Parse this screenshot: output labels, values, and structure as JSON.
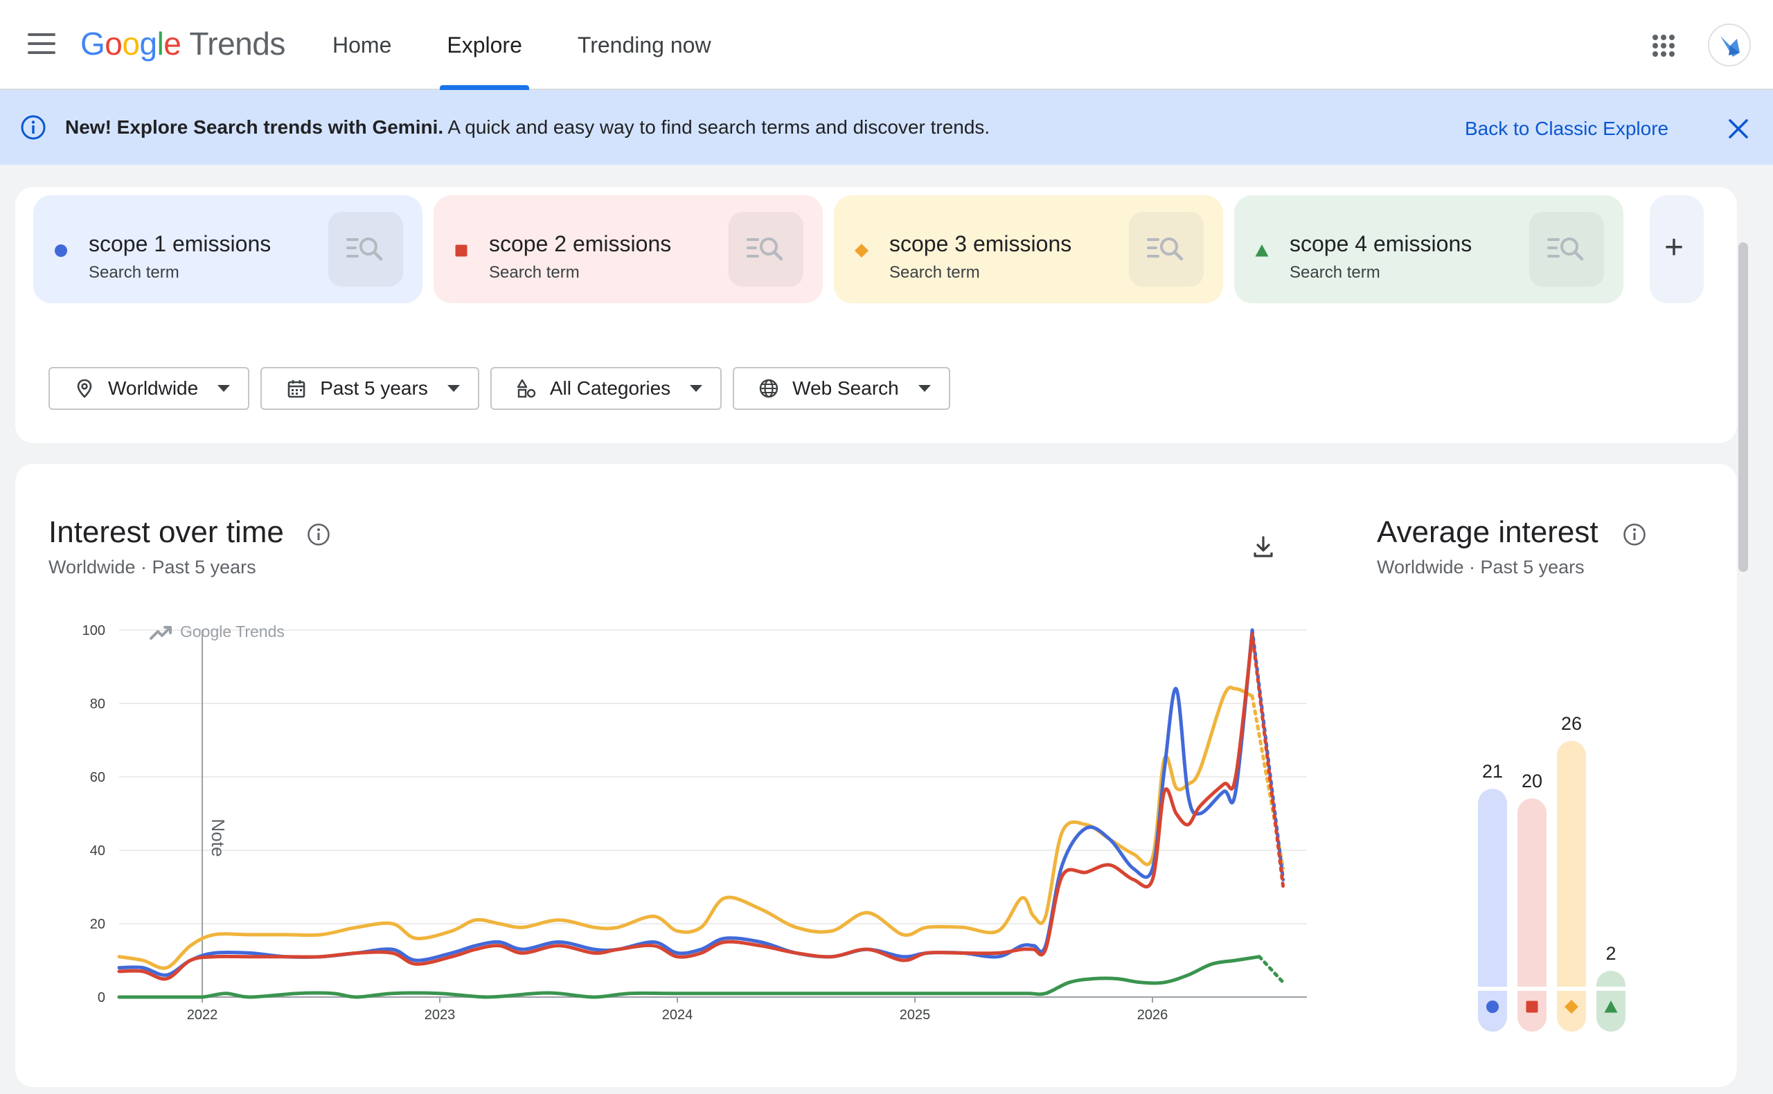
{
  "header": {
    "logo_google": "Google",
    "logo_trends": "Trends",
    "nav": [
      {
        "label": "Home",
        "active": false
      },
      {
        "label": "Explore",
        "active": true
      },
      {
        "label": "Trending now",
        "active": false
      }
    ]
  },
  "banner": {
    "bold": "New! Explore Search trends with Gemini.",
    "text": " A quick and easy way to find search terms and discover trends.",
    "link": "Back to Classic Explore"
  },
  "terms": [
    {
      "name": "scope 1 emissions",
      "sub": "Search term",
      "color": "#4169d9",
      "bg": "#e8efff",
      "btn": "#dde3f0",
      "marker": "circle"
    },
    {
      "name": "scope 2 emissions",
      "sub": "Search term",
      "color": "#d64532",
      "bg": "#fdeceb",
      "btn": "#f0e0df",
      "marker": "square"
    },
    {
      "name": "scope 3 emissions",
      "sub": "Search term",
      "color": "#f0a229",
      "bg": "#fef4d6",
      "btn": "#f3ead2",
      "marker": "diamond"
    },
    {
      "name": "scope 4 emissions",
      "sub": "Search term",
      "color": "#3a944f",
      "bg": "#e7f3ea",
      "btn": "#dde9e0",
      "marker": "triangle"
    }
  ],
  "filters": {
    "location": "Worldwide",
    "time": "Past 5 years",
    "category": "All Categories",
    "property": "Web Search"
  },
  "interest_over_time": {
    "title": "Interest over time",
    "subtitle": "Worldwide  ·  Past 5 years",
    "watermark": "Google Trends",
    "note_label": "Note"
  },
  "average_interest": {
    "title": "Average interest",
    "subtitle": "Worldwide  ·  Past 5 years"
  },
  "chart_data": [
    {
      "type": "line",
      "ylim": [
        0,
        100
      ],
      "yticks": [
        0,
        20,
        40,
        60,
        80,
        100
      ],
      "xlim": [
        2021.65,
        2026.65
      ],
      "xticks": [
        {
          "label": "2022",
          "x": 2022.0
        },
        {
          "label": "2023",
          "x": 2023.0
        },
        {
          "label": "2024",
          "x": 2024.0
        },
        {
          "label": "2025",
          "x": 2025.0
        },
        {
          "label": "2026",
          "x": 2026.0
        }
      ],
      "note_x": 2022.0,
      "series": [
        {
          "name": "scope 1 emissions",
          "color": "#4169d9",
          "x": [
            2021.65,
            2021.75,
            2021.85,
            2021.95,
            2022.05,
            2022.2,
            2022.35,
            2022.5,
            2022.65,
            2022.8,
            2022.9,
            2023.05,
            2023.15,
            2023.25,
            2023.35,
            2023.5,
            2023.65,
            2023.75,
            2023.9,
            2024.0,
            2024.1,
            2024.2,
            2024.35,
            2024.5,
            2024.65,
            2024.8,
            2024.95,
            2025.05,
            2025.2,
            2025.35,
            2025.45,
            2025.5,
            2025.55,
            2025.62,
            2025.72,
            2025.82,
            2025.92,
            2026.0,
            2026.05,
            2026.1,
            2026.15,
            2026.2,
            2026.3,
            2026.35,
            2026.42,
            2026.55
          ],
          "values": [
            8,
            8,
            6,
            10,
            12,
            12,
            11,
            11,
            12,
            13,
            10,
            12,
            14,
            15,
            13,
            15,
            13,
            13,
            15,
            12,
            13,
            16,
            15,
            12,
            11,
            13,
            11,
            12,
            12,
            11,
            14,
            14,
            14,
            36,
            46,
            43,
            35,
            35,
            62,
            84,
            55,
            50,
            56,
            56,
            100,
            32
          ]
        },
        {
          "name": "scope 2 emissions",
          "color": "#d64532",
          "x": [
            2021.65,
            2021.75,
            2021.85,
            2021.95,
            2022.05,
            2022.2,
            2022.35,
            2022.5,
            2022.65,
            2022.8,
            2022.9,
            2023.05,
            2023.15,
            2023.25,
            2023.35,
            2023.5,
            2023.65,
            2023.75,
            2023.9,
            2024.0,
            2024.1,
            2024.2,
            2024.35,
            2024.5,
            2024.65,
            2024.8,
            2024.95,
            2025.05,
            2025.2,
            2025.35,
            2025.45,
            2025.5,
            2025.55,
            2025.62,
            2025.72,
            2025.82,
            2025.92,
            2026.0,
            2026.05,
            2026.1,
            2026.15,
            2026.2,
            2026.3,
            2026.35,
            2026.42,
            2026.55
          ],
          "values": [
            7,
            7,
            5,
            10,
            11,
            11,
            11,
            11,
            12,
            12,
            9,
            11,
            13,
            14,
            12,
            14,
            12,
            13,
            14,
            11,
            12,
            15,
            14,
            12,
            11,
            13,
            10,
            12,
            12,
            12,
            13,
            13,
            13,
            33,
            34,
            36,
            32,
            32,
            56,
            50,
            47,
            52,
            58,
            60,
            99,
            30
          ]
        },
        {
          "name": "scope 3 emissions",
          "color": "#f0b43c",
          "x": [
            2021.65,
            2021.75,
            2021.85,
            2021.95,
            2022.05,
            2022.2,
            2022.35,
            2022.5,
            2022.65,
            2022.8,
            2022.9,
            2023.05,
            2023.15,
            2023.25,
            2023.35,
            2023.5,
            2023.65,
            2023.75,
            2023.9,
            2024.0,
            2024.1,
            2024.2,
            2024.35,
            2024.5,
            2024.65,
            2024.8,
            2024.95,
            2025.05,
            2025.2,
            2025.35,
            2025.45,
            2025.5,
            2025.55,
            2025.62,
            2025.72,
            2025.82,
            2025.92,
            2026.0,
            2026.05,
            2026.1,
            2026.15,
            2026.2,
            2026.3,
            2026.35,
            2026.42,
            2026.55
          ],
          "values": [
            11,
            10,
            8,
            14,
            17,
            17,
            17,
            17,
            19,
            20,
            16,
            18,
            21,
            20,
            19,
            21,
            19,
            19,
            22,
            18,
            19,
            27,
            24,
            19,
            18,
            23,
            17,
            19,
            19,
            18,
            27,
            22,
            22,
            45,
            47,
            43,
            39,
            38,
            65,
            57,
            58,
            62,
            82,
            84,
            82,
            35
          ]
        },
        {
          "name": "scope 4 emissions",
          "color": "#3a944f",
          "x": [
            2021.65,
            2021.8,
            2021.9,
            2022.0,
            2022.1,
            2022.2,
            2022.4,
            2022.55,
            2022.65,
            2022.8,
            2023.0,
            2023.2,
            2023.4,
            2023.5,
            2023.65,
            2023.8,
            2024.0,
            2024.4,
            2024.8,
            2025.0,
            2025.2,
            2025.4,
            2025.48,
            2025.55,
            2025.65,
            2025.75,
            2025.85,
            2025.95,
            2026.05,
            2026.15,
            2026.25,
            2026.35,
            2026.45,
            2026.55
          ],
          "values": [
            0,
            0,
            0,
            0,
            1,
            0,
            1,
            1,
            0,
            1,
            1,
            0,
            1,
            1,
            0,
            1,
            1,
            1,
            1,
            1,
            1,
            1,
            1,
            1,
            4,
            5,
            5,
            4,
            4,
            6,
            9,
            10,
            11,
            4
          ]
        }
      ]
    },
    {
      "type": "bar",
      "ylim": [
        0,
        26
      ],
      "categories": [
        "scope 1 emissions",
        "scope 2 emissions",
        "scope 3 emissions",
        "scope 4 emissions"
      ],
      "values": [
        21,
        20,
        26,
        2
      ],
      "colors": [
        "#4169d9",
        "#d64532",
        "#f0a229",
        "#3a944f"
      ],
      "bar_colors": [
        "#d4ddfb",
        "#f9d9d6",
        "#fde8c2",
        "#cfe6d5"
      ],
      "markers": [
        "circle",
        "square",
        "diamond",
        "triangle"
      ]
    }
  ]
}
